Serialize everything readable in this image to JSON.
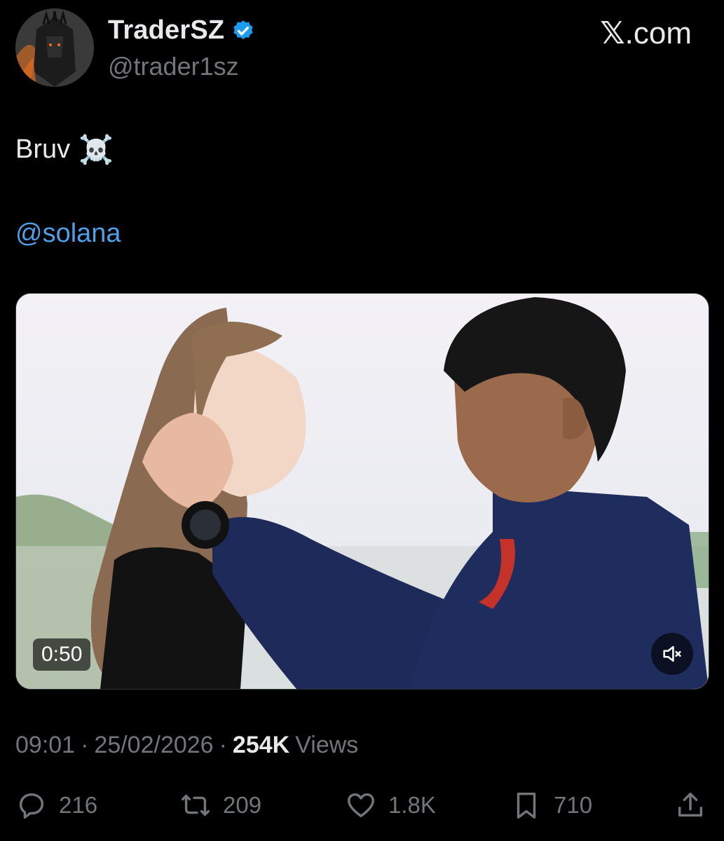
{
  "author": {
    "display_name": "TraderSZ",
    "handle": "@trader1sz",
    "verified": true,
    "verified_color": "#1d9bf0"
  },
  "brand": {
    "x_glyph": "𝕏",
    "suffix": ".com"
  },
  "tweet": {
    "text": "Bruv",
    "emoji": "☠️",
    "mention": "@solana",
    "mention_color": "#4f9fe8"
  },
  "video": {
    "duration": "0:50",
    "muted": true
  },
  "meta": {
    "time": "09:01",
    "separator": "·",
    "date": "25/02/2026",
    "views_count": "254K",
    "views_label": "Views"
  },
  "actions": {
    "replies": "216",
    "reposts": "209",
    "likes": "1.8K",
    "bookmarks": "710"
  },
  "icons": [
    "verified-badge-icon",
    "reply-icon",
    "repost-icon",
    "like-icon",
    "bookmark-icon",
    "share-icon",
    "mute-icon"
  ]
}
